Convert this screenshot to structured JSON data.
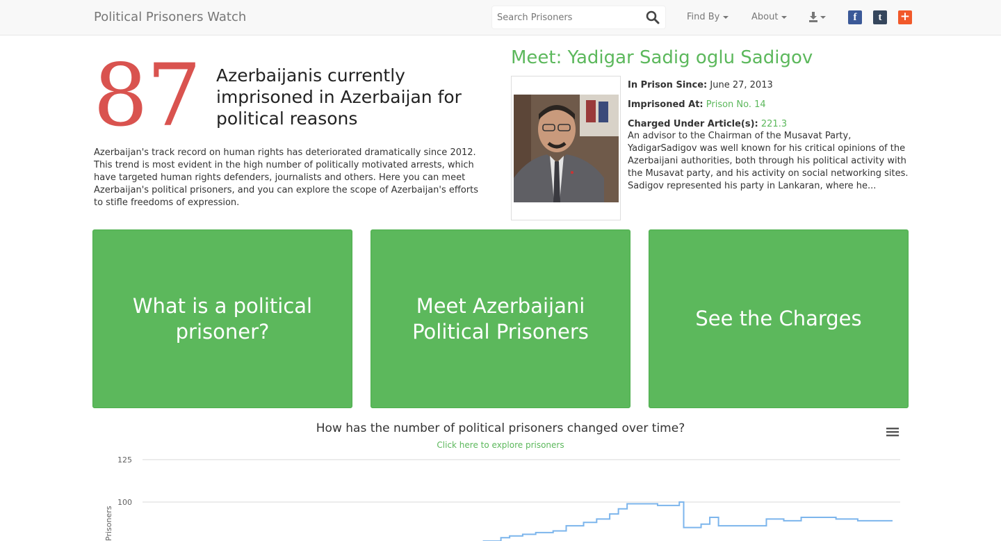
{
  "brand": "Political Prisoners Watch",
  "search": {
    "placeholder": "Search Prisoners"
  },
  "nav": {
    "find_by": "Find By",
    "about": "About"
  },
  "icons": {
    "search": "search-icon",
    "download": "download-icon",
    "facebook": "f",
    "tumblr": "t",
    "share": "+"
  },
  "colors": {
    "accent_green": "#5cb85c",
    "number_red": "#d9534f",
    "facebook": "#3b5998",
    "tumblr": "#35465c",
    "share": "#f1592a"
  },
  "hero": {
    "count": "87",
    "headline": "Azerbaijanis currently imprisoned in Azerbaijan for political reasons",
    "intro": "Azerbaijan's track record on human rights has deteriorated dramatically since 2012. This trend is most evident in the high number of politically motivated arrests, which have targeted human rights defenders, journalists and others. Here you can meet Azerbaijan's political prisoners, and you can explore the scope of Azerbaijan's efforts to stifle freedoms of expression."
  },
  "featured": {
    "title": "Meet: Yadigar Sadig oglu Sadigov",
    "since_label": "In Prison Since:",
    "since_value": "June 27, 2013",
    "prison_label": "Imprisoned At:",
    "prison_value": "Prison No. 14",
    "article_label": "Charged Under Article(s):",
    "article_value": "221.3",
    "bio": "An advisor to the Chairman of the Musavat Party, YadigarSadigov was well known for his critical opinions of the Azerbaijani authorities, both through his political activity with the Musavat party, and his activity on social networking sites. Sadigov represented his party in Lankaran, where he..."
  },
  "tiles": [
    {
      "label": "What is a political prisoner?"
    },
    {
      "label": "Meet Azerbaijani Political Prisoners"
    },
    {
      "label": "See the Charges"
    }
  ],
  "chart_data": {
    "type": "line",
    "title": "How has the number of political prisoners changed over time?",
    "subtitle": "Click here to explore prisoners",
    "ylabel": "Prisoners",
    "ylim": [
      0,
      125
    ],
    "yticks": [
      125,
      100
    ],
    "grid": true,
    "series": [
      {
        "values": [
          [
            0,
            76
          ],
          [
            0.06,
            77
          ],
          [
            0.1,
            79
          ],
          [
            0.12,
            80
          ],
          [
            0.15,
            81
          ],
          [
            0.18,
            82
          ],
          [
            0.22,
            83
          ],
          [
            0.25,
            86
          ],
          [
            0.29,
            88
          ],
          [
            0.32,
            90
          ],
          [
            0.35,
            93
          ],
          [
            0.37,
            96
          ],
          [
            0.39,
            99
          ],
          [
            0.43,
            99
          ],
          [
            0.46,
            98
          ],
          [
            0.5,
            98
          ],
          [
            0.51,
            100
          ],
          [
            0.52,
            85
          ],
          [
            0.56,
            87
          ],
          [
            0.58,
            91
          ],
          [
            0.6,
            86
          ],
          [
            0.68,
            86
          ],
          [
            0.71,
            90
          ],
          [
            0.75,
            89
          ],
          [
            0.79,
            91
          ],
          [
            0.83,
            91
          ],
          [
            0.87,
            90
          ],
          [
            0.92,
            89
          ],
          [
            1,
            89
          ]
        ]
      }
    ]
  }
}
